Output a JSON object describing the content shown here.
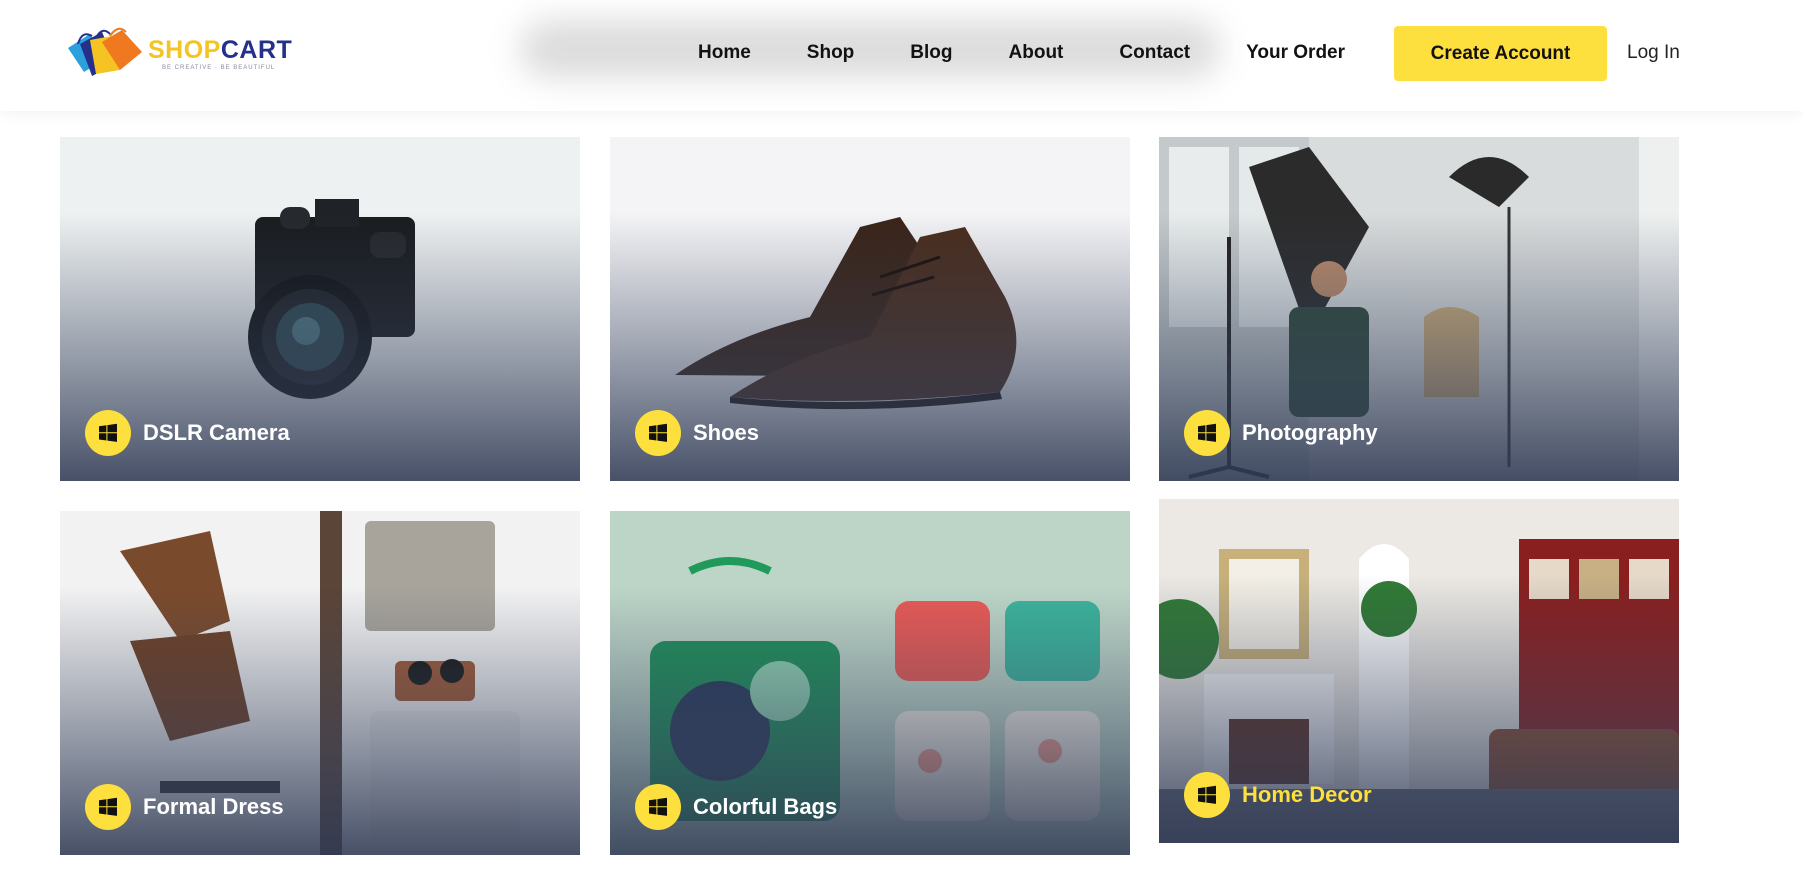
{
  "brand": {
    "name_part1": "SHOP",
    "name_part2": "CART",
    "tagline": "BE CREATIVE · BE BEAUTIFUL",
    "colors": {
      "yellow": "#f5c423",
      "navy": "#24308c",
      "orange": "#f0781e",
      "blue": "#2aa0dc"
    }
  },
  "nav": {
    "items": [
      "Home",
      "Shop",
      "Blog",
      "About",
      "Contact",
      "Your Order"
    ]
  },
  "actions": {
    "create_account": "Create Account",
    "login": "Log In"
  },
  "accent_color": "#fddf3e",
  "categories": [
    {
      "title": "DSLR Camera",
      "icon": "windows-icon"
    },
    {
      "title": "Shoes",
      "icon": "windows-icon"
    },
    {
      "title": "Photography",
      "icon": "windows-icon"
    },
    {
      "title": "Formal Dress",
      "icon": "windows-icon"
    },
    {
      "title": "Colorful Bags",
      "icon": "windows-icon"
    },
    {
      "title": "Home Decor",
      "icon": "windows-icon",
      "highlighted": true
    }
  ]
}
